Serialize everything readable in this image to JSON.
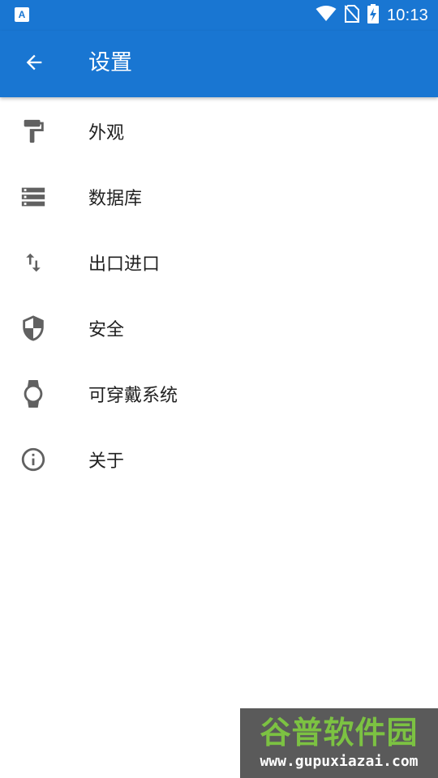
{
  "status_bar": {
    "notification_icon": "A",
    "time": "10:13",
    "icons": [
      "wifi-icon",
      "no-sim-icon",
      "battery-charging-icon"
    ]
  },
  "app_bar": {
    "title": "设置",
    "back_icon": "arrow-back-icon",
    "color": "#1976d2"
  },
  "menu": {
    "items": [
      {
        "label": "外观",
        "icon": "paint-roller-icon"
      },
      {
        "label": "数据库",
        "icon": "storage-icon"
      },
      {
        "label": "出口进口",
        "icon": "import-export-icon"
      },
      {
        "label": "安全",
        "icon": "security-shield-icon"
      },
      {
        "label": "可穿戴系统",
        "icon": "watch-icon"
      },
      {
        "label": "关于",
        "icon": "info-icon"
      }
    ]
  },
  "watermark": {
    "title": "谷普软件园",
    "url": "www.gupuxiazai.com"
  }
}
